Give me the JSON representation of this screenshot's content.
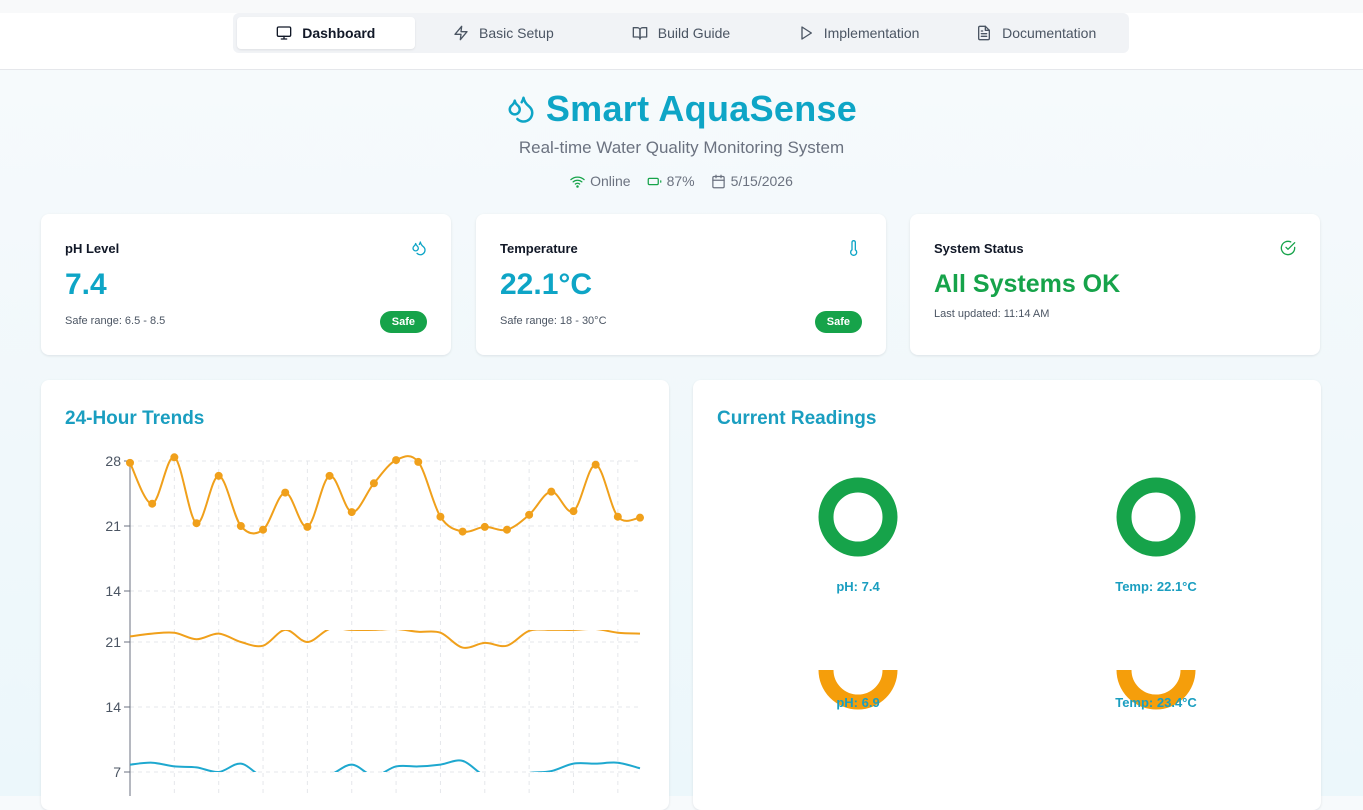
{
  "nav": {
    "tabs": [
      {
        "label": "Dashboard",
        "icon": "monitor-icon",
        "active": true
      },
      {
        "label": "Basic Setup",
        "icon": "zap-icon",
        "active": false
      },
      {
        "label": "Build Guide",
        "icon": "book-icon",
        "active": false
      },
      {
        "label": "Implementation",
        "icon": "play-icon",
        "active": false
      },
      {
        "label": "Documentation",
        "icon": "file-text-icon",
        "active": false
      }
    ]
  },
  "header": {
    "title": "Smart AquaSense",
    "subtitle": "Real-time Water Quality Monitoring System",
    "status": {
      "connection": "Online",
      "battery": "87%",
      "date": "5/15/2026"
    }
  },
  "stats": {
    "ph": {
      "title": "pH Level",
      "value": "7.4",
      "note": "Safe range: 6.5 - 8.5",
      "badge": "Safe",
      "icon": "droplets-icon"
    },
    "temperature": {
      "title": "Temperature",
      "value": "22.1°C",
      "note": "Safe range: 18 - 30°C",
      "badge": "Safe",
      "icon": "thermometer-icon"
    },
    "system": {
      "title": "System Status",
      "value": "All Systems OK",
      "note": "Last updated: 11:14 AM",
      "icon": "check-circle-icon"
    }
  },
  "trends": {
    "title": "24-Hour Trends",
    "chart_data": {
      "type": "line",
      "x": [
        0,
        1,
        2,
        3,
        4,
        5,
        6,
        7,
        8,
        9,
        10,
        11,
        12,
        13,
        14,
        15,
        16,
        17,
        18,
        19,
        20,
        21,
        22,
        23
      ],
      "y_ticks_upper": [
        28,
        21,
        14
      ],
      "y_ticks_lower": [
        21,
        14,
        7
      ],
      "ylim_upper": [
        14,
        28
      ],
      "ylim_lower": [
        7,
        21
      ],
      "grid": true,
      "series": [
        {
          "values": [
            27.8,
            23.4,
            28.4,
            21.3,
            26.4,
            21.0,
            20.6,
            24.6,
            20.9,
            26.4,
            22.5,
            25.6,
            28.1,
            27.9,
            22.0,
            20.4,
            20.9,
            20.6,
            22.2,
            24.7,
            22.6,
            27.6,
            22.0,
            21.9
          ],
          "color": "#f0a01b",
          "markers": true
        },
        {
          "values": [
            21.6,
            21.9,
            22.0,
            21.3,
            21.9,
            21.0,
            20.6,
            22.3,
            21.0,
            22.4,
            22.3,
            22.3,
            22.4,
            22.1,
            22.0,
            20.4,
            20.9,
            20.6,
            22.2,
            22.3,
            22.3,
            22.4,
            22.0,
            21.9
          ],
          "color": "#f0a01b",
          "markers": false
        },
        {
          "values": [
            7.8,
            8.0,
            7.6,
            7.5,
            7.0,
            7.9,
            6.5,
            6.8,
            6.7,
            6.7,
            7.8,
            6.6,
            7.6,
            7.6,
            7.8,
            8.2,
            6.6,
            6.4,
            6.9,
            7.1,
            7.9,
            7.9,
            8.0,
            7.4
          ],
          "color": "#1ea8cf",
          "markers": false
        }
      ]
    }
  },
  "readings": {
    "title": "Current Readings",
    "gauges": [
      {
        "label": "pH: 7.4",
        "color": "#16a34a",
        "fraction": 1.0
      },
      {
        "label": "Temp: 22.1°C",
        "color": "#16a34a",
        "fraction": 1.0
      },
      {
        "label": "pH: 6.9",
        "color": "#f59e0b",
        "fraction": 0.5
      },
      {
        "label": "Temp: 23.4°C",
        "color": "#f59e0b",
        "fraction": 0.5
      }
    ]
  }
}
